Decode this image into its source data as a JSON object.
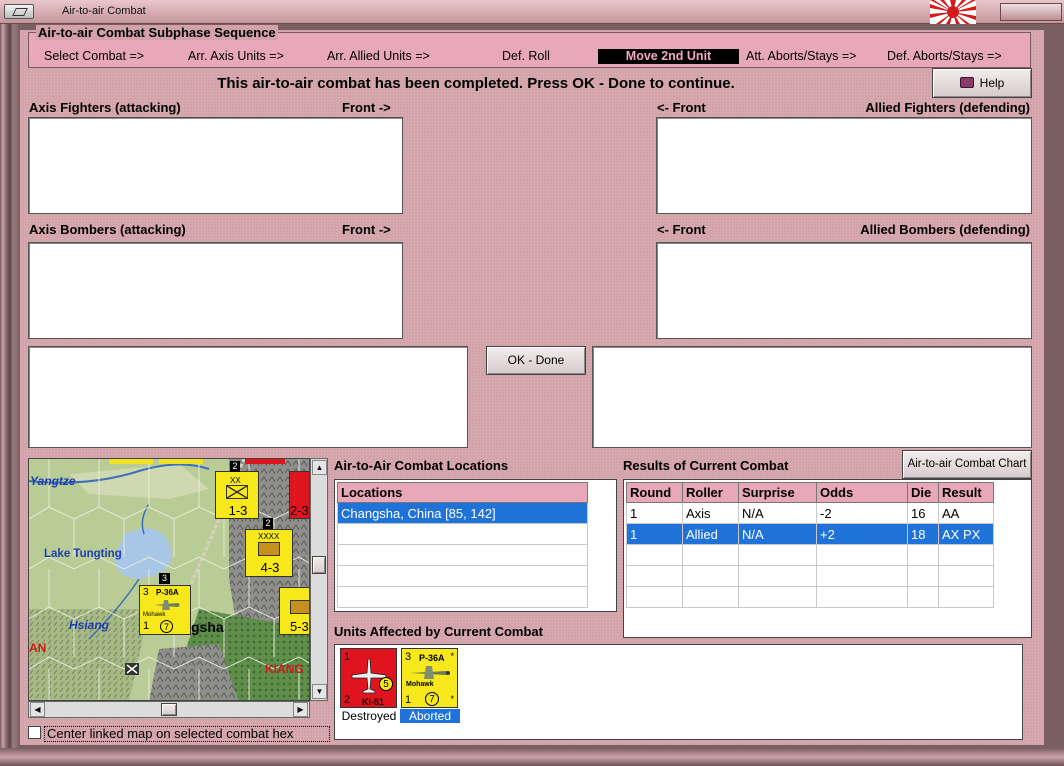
{
  "window": {
    "title": "Air-to-air Combat"
  },
  "sequence": {
    "title": "Air-to-air Combat Subphase Sequence",
    "steps": [
      "Select Combat =>",
      "Arr. Axis Units =>",
      "Arr. Allied Units =>",
      "Def. Roll",
      "Move 2nd Unit",
      "Att. Aborts/Stays =>",
      "Def. Aborts/Stays =>"
    ],
    "active_index": 4
  },
  "banner": "This air-to-air combat has been completed.  Press OK - Done to continue.",
  "help_label": "Help",
  "labels": {
    "axis_fighters": "Axis Fighters (attacking)",
    "front_right": "Front ->",
    "front_left": "<- Front",
    "allied_fighters": "Allied Fighters (defending)",
    "axis_bombers": "Axis Bombers (attacking)",
    "allied_bombers": "Allied Bombers (defending)"
  },
  "ok_label": "OK - Done",
  "map": {
    "places": [
      "Yangtze",
      "Lake Tungting",
      "Hsiang",
      "gsha",
      "AN",
      "KIANG"
    ],
    "counters": [
      {
        "top": "2",
        "type": "XX",
        "value": "1-3"
      },
      {
        "top": "2",
        "type": "XXXX",
        "value": "4-3"
      },
      {
        "top": "",
        "type": "",
        "value": "2-3"
      },
      {
        "top": "",
        "type": "",
        "value": "5-3"
      }
    ],
    "stack_count": "3",
    "air_counter": {
      "rating": "3",
      "name": "P-36A",
      "sub": "Mohawk",
      "low": "1",
      "range": "7"
    }
  },
  "center_checkbox": {
    "label": "Center linked map on selected combat hex",
    "checked": false
  },
  "locations": {
    "title": "Air-to-Air Combat Locations",
    "header": "Locations",
    "rows": [
      "Changsha, China [85, 142]",
      "",
      "",
      "",
      ""
    ],
    "selected": 0
  },
  "results": {
    "title": "Results of Current Combat",
    "chart_button": "Air-to-air Combat Chart",
    "columns": [
      "Round",
      "Roller",
      "Surprise",
      "Odds",
      "Die",
      "Result"
    ],
    "rows": [
      [
        "1",
        "Axis",
        "N/A",
        "-2",
        "16",
        "AA"
      ],
      [
        "1",
        "Allied",
        "N/A",
        "+2",
        "18",
        "AX PX"
      ],
      [
        "",
        "",
        "",
        "",
        "",
        ""
      ],
      [
        "",
        "",
        "",
        "",
        "",
        ""
      ],
      [
        "",
        "",
        "",
        "",
        "",
        ""
      ]
    ],
    "selected": 1
  },
  "units": {
    "title": "Units Affected by Current Combat",
    "items": [
      {
        "top": "1",
        "name": "Ki-51",
        "bottom": "2",
        "value": "5",
        "status": "Destroyed",
        "color": "#e0141e"
      },
      {
        "top": "3",
        "name": "P-36A",
        "sub": "Mohawk",
        "bottom": "1",
        "value": "7",
        "status": "Aborted",
        "color": "#f7e81c"
      }
    ]
  },
  "colors": {
    "panel": "#d2a2a8",
    "header": "#e8a8ba",
    "selection": "#1f73d8"
  }
}
